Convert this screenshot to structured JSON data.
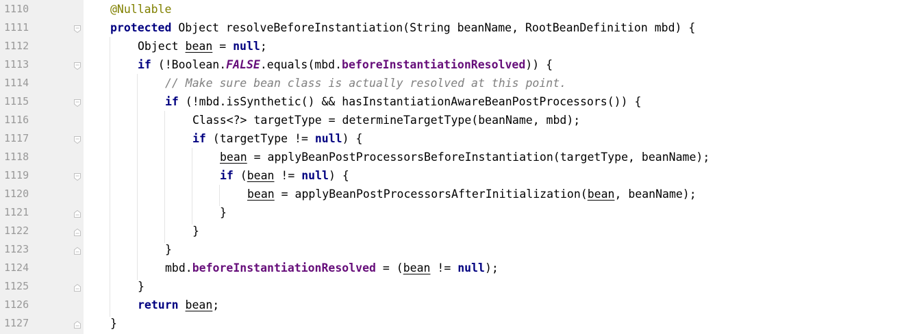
{
  "editor": {
    "lines": [
      {
        "number": "1110",
        "indent": 0,
        "fold": "none",
        "tokens": [
          {
            "t": "@Nullable",
            "c": "ann"
          }
        ]
      },
      {
        "number": "1111",
        "indent": 0,
        "fold": "open",
        "tokens": [
          {
            "t": "protected",
            "c": "kw"
          },
          {
            "t": " Object resolveBeforeInstantiation(String beanName, RootBeanDefinition mbd) {",
            "c": "plain"
          }
        ]
      },
      {
        "number": "1112",
        "indent": 1,
        "fold": "none",
        "tokens": [
          {
            "t": "Object ",
            "c": "plain"
          },
          {
            "t": "bean",
            "c": "var"
          },
          {
            "t": " = ",
            "c": "plain"
          },
          {
            "t": "null",
            "c": "kw"
          },
          {
            "t": ";",
            "c": "plain"
          }
        ]
      },
      {
        "number": "1113",
        "indent": 1,
        "fold": "open",
        "tokens": [
          {
            "t": "if",
            "c": "kw"
          },
          {
            "t": " (!Boolean.",
            "c": "plain"
          },
          {
            "t": "FALSE",
            "c": "const"
          },
          {
            "t": ".equals(mbd.",
            "c": "plain"
          },
          {
            "t": "beforeInstantiationResolved",
            "c": "field"
          },
          {
            "t": ")) {",
            "c": "plain"
          }
        ]
      },
      {
        "number": "1114",
        "indent": 2,
        "fold": "none",
        "tokens": [
          {
            "t": "// Make sure bean class is actually resolved at this point.",
            "c": "comment"
          }
        ]
      },
      {
        "number": "1115",
        "indent": 2,
        "fold": "open",
        "tokens": [
          {
            "t": "if",
            "c": "kw"
          },
          {
            "t": " (!mbd.isSynthetic() && hasInstantiationAwareBeanPostProcessors()) {",
            "c": "plain"
          }
        ]
      },
      {
        "number": "1116",
        "indent": 3,
        "fold": "none",
        "tokens": [
          {
            "t": "Class<?> targetType = determineTargetType(beanName, mbd);",
            "c": "plain"
          }
        ]
      },
      {
        "number": "1117",
        "indent": 3,
        "fold": "open",
        "tokens": [
          {
            "t": "if",
            "c": "kw"
          },
          {
            "t": " (targetType != ",
            "c": "plain"
          },
          {
            "t": "null",
            "c": "kw"
          },
          {
            "t": ") {",
            "c": "plain"
          }
        ]
      },
      {
        "number": "1118",
        "indent": 4,
        "fold": "none",
        "tokens": [
          {
            "t": "bean",
            "c": "var"
          },
          {
            "t": " = applyBeanPostProcessorsBeforeInstantiation(targetType, beanName);",
            "c": "plain"
          }
        ]
      },
      {
        "number": "1119",
        "indent": 4,
        "fold": "open",
        "tokens": [
          {
            "t": "if",
            "c": "kw"
          },
          {
            "t": " (",
            "c": "plain"
          },
          {
            "t": "bean",
            "c": "var"
          },
          {
            "t": " != ",
            "c": "plain"
          },
          {
            "t": "null",
            "c": "kw"
          },
          {
            "t": ") {",
            "c": "plain"
          }
        ]
      },
      {
        "number": "1120",
        "indent": 5,
        "fold": "none",
        "tokens": [
          {
            "t": "bean",
            "c": "var"
          },
          {
            "t": " = applyBeanPostProcessorsAfterInitialization(",
            "c": "plain"
          },
          {
            "t": "bean",
            "c": "var"
          },
          {
            "t": ", beanName);",
            "c": "plain"
          }
        ]
      },
      {
        "number": "1121",
        "indent": 4,
        "fold": "close",
        "tokens": [
          {
            "t": "}",
            "c": "plain"
          }
        ]
      },
      {
        "number": "1122",
        "indent": 3,
        "fold": "close",
        "tokens": [
          {
            "t": "}",
            "c": "plain"
          }
        ]
      },
      {
        "number": "1123",
        "indent": 2,
        "fold": "close",
        "tokens": [
          {
            "t": "}",
            "c": "plain"
          }
        ]
      },
      {
        "number": "1124",
        "indent": 2,
        "fold": "none",
        "tokens": [
          {
            "t": "mbd.",
            "c": "plain"
          },
          {
            "t": "beforeInstantiationResolved",
            "c": "field"
          },
          {
            "t": " = (",
            "c": "plain"
          },
          {
            "t": "bean",
            "c": "var"
          },
          {
            "t": " != ",
            "c": "plain"
          },
          {
            "t": "null",
            "c": "kw"
          },
          {
            "t": ");",
            "c": "plain"
          }
        ]
      },
      {
        "number": "1125",
        "indent": 1,
        "fold": "close",
        "tokens": [
          {
            "t": "}",
            "c": "plain"
          }
        ]
      },
      {
        "number": "1126",
        "indent": 1,
        "fold": "none",
        "tokens": [
          {
            "t": "return",
            "c": "kw"
          },
          {
            "t": " ",
            "c": "plain"
          },
          {
            "t": "bean",
            "c": "var"
          },
          {
            "t": ";",
            "c": "plain"
          }
        ]
      },
      {
        "number": "1127",
        "indent": 0,
        "fold": "close",
        "tokens": [
          {
            "t": "}",
            "c": "plain"
          }
        ]
      }
    ]
  },
  "colors": {
    "keyword": "#000080",
    "annotation": "#808000",
    "field": "#660e7a",
    "comment": "#808080",
    "line_number": "#999999",
    "gutter_bg": "#f0f0f0",
    "fold_marker": "#c0c0c0",
    "indent_guide": "#e4e4e4"
  },
  "icons": {
    "fold_open": "fold-open-icon",
    "fold_close": "fold-close-icon"
  }
}
